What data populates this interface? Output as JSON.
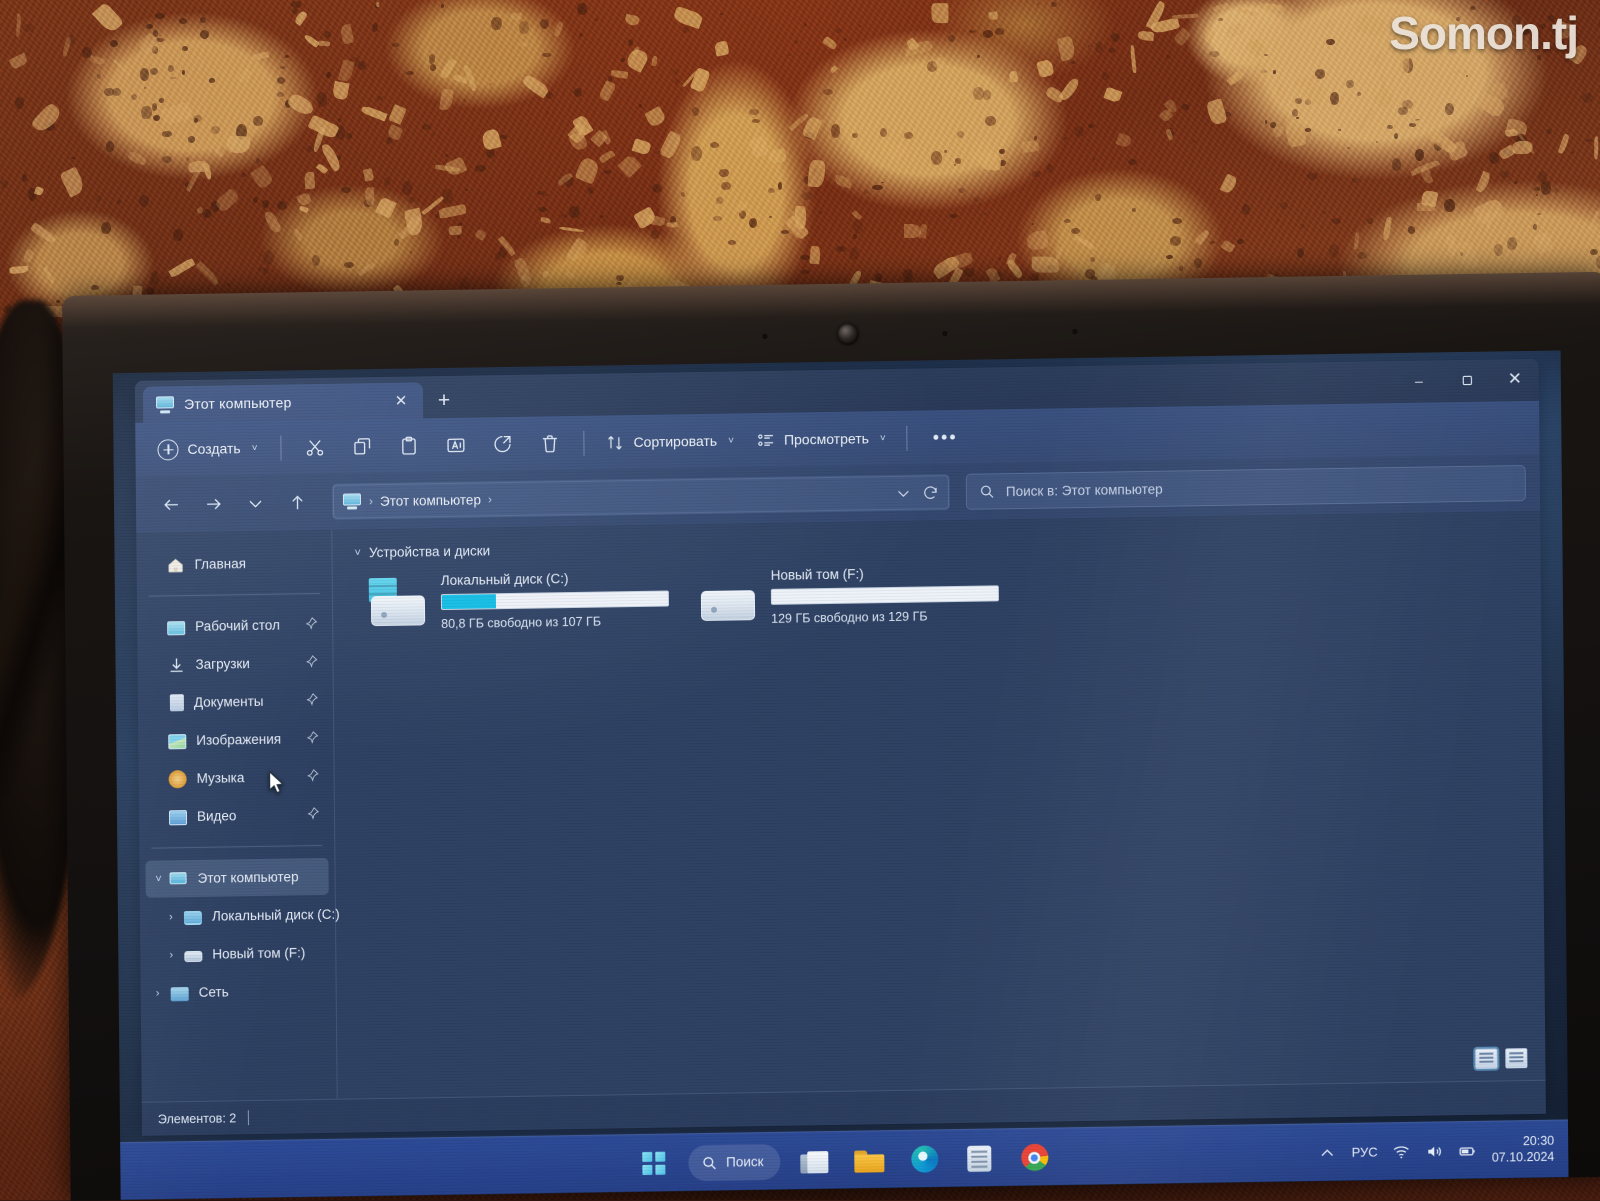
{
  "watermark": "Somon.tj",
  "window": {
    "tab_title": "Этот компьютер",
    "tab_close_icon": "close-icon",
    "new_tab_icon": "plus-icon",
    "minimize": "–",
    "maximize": "❐",
    "close": "✕"
  },
  "toolbar": {
    "new_label": "Создать",
    "caret": "˅",
    "cut_icon": "scissors-icon",
    "copy_icon": "copy-icon",
    "paste_icon": "clipboard-paste-icon",
    "rename_icon": "rename-icon",
    "share_icon": "share-icon",
    "delete_icon": "trash-icon",
    "sort_label": "Сортировать",
    "view_label": "Просмотреть",
    "more_label": "•••"
  },
  "navbar": {
    "back_icon": "arrow-left-icon",
    "forward_icon": "arrow-right-icon",
    "recent_icon": "chevron-down-icon",
    "up_icon": "arrow-up-icon",
    "breadcrumb_icon": "this-pc-icon",
    "breadcrumb_sep_left": "›",
    "breadcrumb": "Этот компьютер",
    "breadcrumb_sep_right": "›",
    "dropdown_icon": "chevron-down-icon",
    "refresh_icon": "refresh-icon",
    "search_icon": "search-icon",
    "search_placeholder": "Поиск в: Этот компьютер"
  },
  "sidebar": {
    "home": {
      "label": "Главная",
      "icon": "home-icon"
    },
    "quick_access": [
      {
        "label": "Рабочий стол",
        "icon": "desktop-icon",
        "pinned": true
      },
      {
        "label": "Загрузки",
        "icon": "downloads-icon",
        "pinned": true
      },
      {
        "label": "Документы",
        "icon": "documents-icon",
        "pinned": true
      },
      {
        "label": "Изображения",
        "icon": "pictures-icon",
        "pinned": true
      },
      {
        "label": "Музыка",
        "icon": "music-icon",
        "pinned": true
      },
      {
        "label": "Видео",
        "icon": "video-icon",
        "pinned": true
      }
    ],
    "tree": [
      {
        "label": "Этот компьютер",
        "icon": "this-pc-icon",
        "expanded": true,
        "selected": true,
        "arrow": "˅"
      },
      {
        "label": "Локальный диск (C:)",
        "icon": "drive-icon",
        "arrow": "›",
        "indent": 1
      },
      {
        "label": "Новый том (F:)",
        "icon": "drive-icon",
        "arrow": "›",
        "indent": 1
      },
      {
        "label": "Сеть",
        "icon": "network-icon",
        "arrow": "›",
        "indent": 0
      }
    ]
  },
  "content": {
    "group_title": "Устройства и диски",
    "group_chevron": "˅",
    "drives": [
      {
        "name": "Локальный диск (C:)",
        "free_text": "80,8 ГБ свободно из 107 ГБ",
        "used_percent": 24,
        "bar_color": "#14bde6"
      },
      {
        "name": "Новый том (F:)",
        "free_text": "129 ГБ свободно из 129 ГБ",
        "used_percent": 0,
        "bar_color": "#14bde6"
      }
    ],
    "view_details_icon": "details-view-icon",
    "view_tiles_icon": "tiles-view-icon"
  },
  "statusbar": {
    "items_count": "Элементов: 2"
  },
  "taskbar": {
    "start_icon": "windows-start-icon",
    "search_label": "Поиск",
    "search_icon": "search-icon",
    "explorer_icon": "file-explorer-icon",
    "folder_icon": "folder-icon",
    "edge_icon": "edge-icon",
    "store_icon": "store-icon",
    "chrome_icon": "chrome-icon",
    "tray": {
      "chevron_icon": "chevron-up-icon",
      "language": "РУС",
      "wifi_icon": "wifi-icon",
      "volume_icon": "volume-icon",
      "battery_icon": "battery-icon",
      "time": "20:30",
      "date": "07.10.2024"
    }
  }
}
